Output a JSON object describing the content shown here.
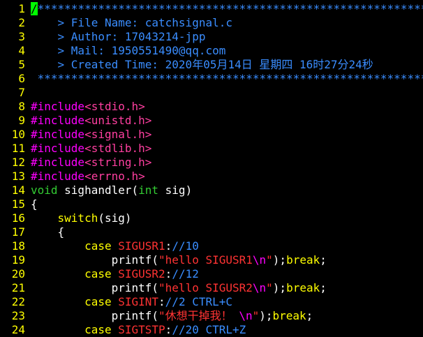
{
  "colors": {
    "background": "#000000",
    "line_number": "#ffff00",
    "default": "#ffffff",
    "comment": "#3a8dff",
    "preproc": "#ff00ff",
    "include_path": "#ff3fa0",
    "type": "#33cc33",
    "statement": "#ffff00",
    "constant": "#ff3333",
    "string": "#ff3333",
    "special": "#ff00ff",
    "cursor": "#00ff00"
  },
  "lines": [
    {
      "n": "1",
      "segs": [
        {
          "t": "/",
          "c": "cursor"
        },
        {
          "t": "*************************************************************",
          "c": "comment"
        }
      ]
    },
    {
      "n": "2",
      "segs": [
        {
          "t": "    > File Name: catchsignal.c",
          "c": "comment"
        }
      ]
    },
    {
      "n": "3",
      "segs": [
        {
          "t": "    > Author: 17043214-jpp",
          "c": "comment"
        }
      ]
    },
    {
      "n": "4",
      "segs": [
        {
          "t": "    > Mail: 1950551490@qq.com",
          "c": "comment"
        }
      ]
    },
    {
      "n": "5",
      "segs": [
        {
          "t": "    > Created Time: 2020年05月14日 星期四 16时27分24秒",
          "c": "comment"
        }
      ]
    },
    {
      "n": "6",
      "segs": [
        {
          "t": " ************************************************************/",
          "c": "comment"
        }
      ]
    },
    {
      "n": "7",
      "segs": []
    },
    {
      "n": "8",
      "segs": [
        {
          "t": "#include",
          "c": "preproc"
        },
        {
          "t": "<stdio.h>",
          "c": "include_path"
        }
      ]
    },
    {
      "n": "9",
      "segs": [
        {
          "t": "#include",
          "c": "preproc"
        },
        {
          "t": "<unistd.h>",
          "c": "include_path"
        }
      ]
    },
    {
      "n": "10",
      "segs": [
        {
          "t": "#include",
          "c": "preproc"
        },
        {
          "t": "<signal.h>",
          "c": "include_path"
        }
      ]
    },
    {
      "n": "11",
      "segs": [
        {
          "t": "#include",
          "c": "preproc"
        },
        {
          "t": "<stdlib.h>",
          "c": "include_path"
        }
      ]
    },
    {
      "n": "12",
      "segs": [
        {
          "t": "#include",
          "c": "preproc"
        },
        {
          "t": "<string.h>",
          "c": "include_path"
        }
      ]
    },
    {
      "n": "13",
      "segs": [
        {
          "t": "#include",
          "c": "preproc"
        },
        {
          "t": "<errno.h>",
          "c": "include_path"
        }
      ]
    },
    {
      "n": "14",
      "segs": [
        {
          "t": "void",
          "c": "type"
        },
        {
          "t": " sighandler(",
          "c": "default"
        },
        {
          "t": "int",
          "c": "type"
        },
        {
          "t": " sig)",
          "c": "default"
        }
      ]
    },
    {
      "n": "15",
      "segs": [
        {
          "t": "{",
          "c": "default"
        }
      ]
    },
    {
      "n": "16",
      "segs": [
        {
          "t": "    ",
          "c": "default"
        },
        {
          "t": "switch",
          "c": "statement"
        },
        {
          "t": "(sig)",
          "c": "default"
        }
      ]
    },
    {
      "n": "17",
      "segs": [
        {
          "t": "    {",
          "c": "default"
        }
      ]
    },
    {
      "n": "18",
      "segs": [
        {
          "t": "        ",
          "c": "default"
        },
        {
          "t": "case",
          "c": "statement"
        },
        {
          "t": " ",
          "c": "default"
        },
        {
          "t": "SIGUSR1",
          "c": "constant"
        },
        {
          "t": ":",
          "c": "default"
        },
        {
          "t": "//10",
          "c": "comment"
        }
      ]
    },
    {
      "n": "19",
      "segs": [
        {
          "t": "            printf(",
          "c": "default"
        },
        {
          "t": "\"hello SIGUSR1",
          "c": "string"
        },
        {
          "t": "\\n",
          "c": "special"
        },
        {
          "t": "\"",
          "c": "string"
        },
        {
          "t": ");",
          "c": "default"
        },
        {
          "t": "break",
          "c": "statement"
        },
        {
          "t": ";",
          "c": "default"
        }
      ]
    },
    {
      "n": "20",
      "segs": [
        {
          "t": "        ",
          "c": "default"
        },
        {
          "t": "case",
          "c": "statement"
        },
        {
          "t": " ",
          "c": "default"
        },
        {
          "t": "SIGUSR2",
          "c": "constant"
        },
        {
          "t": ":",
          "c": "default"
        },
        {
          "t": "//12",
          "c": "comment"
        }
      ]
    },
    {
      "n": "21",
      "segs": [
        {
          "t": "            printf(",
          "c": "default"
        },
        {
          "t": "\"hello SIGUSR2",
          "c": "string"
        },
        {
          "t": "\\n",
          "c": "special"
        },
        {
          "t": "\"",
          "c": "string"
        },
        {
          "t": ");",
          "c": "default"
        },
        {
          "t": "break",
          "c": "statement"
        },
        {
          "t": ";",
          "c": "default"
        }
      ]
    },
    {
      "n": "22",
      "segs": [
        {
          "t": "        ",
          "c": "default"
        },
        {
          "t": "case",
          "c": "statement"
        },
        {
          "t": " ",
          "c": "default"
        },
        {
          "t": "SIGINT",
          "c": "constant"
        },
        {
          "t": ":",
          "c": "default"
        },
        {
          "t": "//2 CTRL+C",
          "c": "comment"
        }
      ]
    },
    {
      "n": "23",
      "segs": [
        {
          "t": "            printf(",
          "c": "default"
        },
        {
          "t": "\"休想干掉我！ ",
          "c": "string"
        },
        {
          "t": "\\n",
          "c": "special"
        },
        {
          "t": "\"",
          "c": "string"
        },
        {
          "t": ");",
          "c": "default"
        },
        {
          "t": "break",
          "c": "statement"
        },
        {
          "t": ";",
          "c": "default"
        }
      ]
    },
    {
      "n": "24",
      "segs": [
        {
          "t": "        ",
          "c": "default"
        },
        {
          "t": "case",
          "c": "statement"
        },
        {
          "t": " ",
          "c": "default"
        },
        {
          "t": "SIGTSTP",
          "c": "constant"
        },
        {
          "t": ":",
          "c": "default"
        },
        {
          "t": "//20 CTRL+Z",
          "c": "comment"
        }
      ]
    }
  ]
}
